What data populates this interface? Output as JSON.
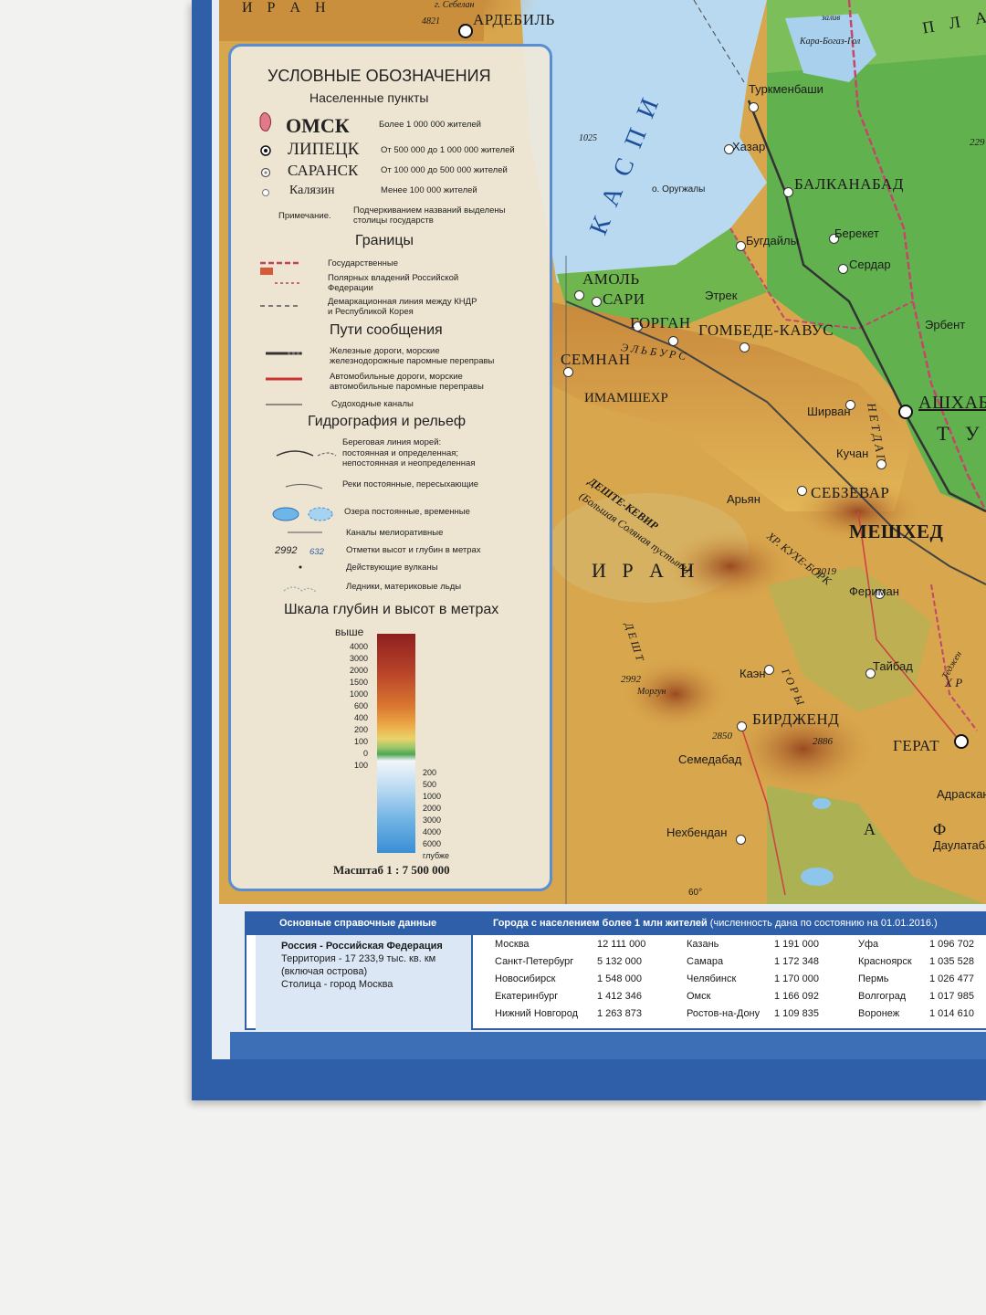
{
  "map": {
    "cities": [
      {
        "name": "АРДЕБИЛЬ",
        "big": false
      },
      {
        "name": "Туркменбаши",
        "big": false
      },
      {
        "name": "Хазар",
        "big": false
      },
      {
        "name": "БАЛКАНАБАД",
        "big": false
      },
      {
        "name": "Берекет",
        "big": false
      },
      {
        "name": "Бугдайлы",
        "big": false
      },
      {
        "name": "Сердар",
        "big": false
      },
      {
        "name": "Этрек",
        "big": false
      },
      {
        "name": "АМОЛЬ",
        "big": false
      },
      {
        "name": "САРИ",
        "big": false
      },
      {
        "name": "ГОРГАН",
        "big": false
      },
      {
        "name": "ГОМБЕДЕ-КАВУС",
        "big": false
      },
      {
        "name": "СЕМНАН",
        "big": false
      },
      {
        "name": "ИМАМШЕХР",
        "big": false
      },
      {
        "name": "Эрбент",
        "big": false
      },
      {
        "name": "АШХАБ",
        "big": false
      },
      {
        "name": "Ширван",
        "big": false
      },
      {
        "name": "Кучан",
        "big": false
      },
      {
        "name": "Арьян",
        "big": false
      },
      {
        "name": "СЕБЗЕВАР",
        "big": false
      },
      {
        "name": "МЕШХЕД",
        "big": true
      },
      {
        "name": "Фериман",
        "big": false
      },
      {
        "name": "Тайбад",
        "big": false
      },
      {
        "name": "Каэн",
        "big": false
      },
      {
        "name": "БИРДЖЕНД",
        "big": false
      },
      {
        "name": "ГЕРАТ",
        "big": false
      },
      {
        "name": "Семедабад",
        "big": false
      },
      {
        "name": "Нехбендан",
        "big": false
      },
      {
        "name": "Адраскан",
        "big": false
      },
      {
        "name": "Даулатабад",
        "big": false
      }
    ],
    "sea_label": "К А С П И",
    "country_iran": "И Р А Н",
    "country_iran_top": "И Р А Н",
    "country_tu": "Т У",
    "plateau": "П Л А",
    "desert_title": "ДЕШТЕ-КЕВИР",
    "desert_sub": "(Большая Соляная пустыня)",
    "range1": "ХР. КУХЕ-БОРК",
    "range2": "Г О Р Ы",
    "range3": "Д Е Ш Т",
    "river": "Э Л Ь Б У Р С",
    "bay": "залив",
    "bay_name": "Кара-Богаз-Гол",
    "island": "о. Оругжалы",
    "depth1": "1025",
    "heights": [
      "4821",
      "2992",
      "2850",
      "2886",
      "3019",
      "229"
    ],
    "morgun": "Моргун",
    "sebelan": "г. Себелан",
    "meridian": "60°",
    "kopet": "Н Е Т Д А Г",
    "kh": "Х Р",
    "a_letter": "А",
    "f_letter": "Ф",
    "tejen": "Теджен"
  },
  "legend": {
    "title": "УСЛОВНЫЕ ОБОЗНАЧЕНИЯ",
    "settlements_title": "Населенные пункты",
    "settlements": [
      {
        "name": "ОМСК",
        "desc": "Более 1 000 000 жителей"
      },
      {
        "name": "ЛИПЕЦК",
        "desc": "От 500 000 до 1 000 000 жителей"
      },
      {
        "name": "САРАНСК",
        "desc": "От 100 000 до 500 000 жителей"
      },
      {
        "name": "Калязин",
        "desc": "Менее 100 000 жителей"
      }
    ],
    "note_label": "Примечание.",
    "note_text_1": "Подчеркиванием названий выделены",
    "note_text_2": "столицы государств",
    "borders_title": "Границы",
    "borders": [
      {
        "l1": "Государственные",
        "l2": ""
      },
      {
        "l1": "Полярных владений Российской",
        "l2": "Федерации"
      },
      {
        "l1": "Демаркационная линия между КНДР",
        "l2": "и Республикой Корея"
      }
    ],
    "routes_title": "Пути сообщения",
    "routes": [
      {
        "l1": "Железные дороги, морские",
        "l2": "железнодорожные паромные переправы"
      },
      {
        "l1": "Автомобильные дороги, морские",
        "l2": "автомобильные паромные переправы"
      },
      {
        "l1": "Судоходные каналы",
        "l2": ""
      }
    ],
    "hydro_title": "Гидрография и рельеф",
    "hydro": [
      {
        "l1": "Береговая линия морей:",
        "l2": "постоянная и определенная;",
        "l3": "непостоянная и неопределенная"
      },
      {
        "l1": "Реки постоянные, пересыхающие",
        "l2": "",
        "l3": ""
      },
      {
        "l1": "Озера постоянные, временные",
        "l2": "",
        "l3": ""
      },
      {
        "l1": "Каналы мелиоративные",
        "l2": "",
        "l3": ""
      },
      {
        "l1": "Отметки высот и глубин в метрах",
        "l2": "",
        "l3": ""
      },
      {
        "l1": "Действующие вулканы",
        "l2": "",
        "l3": ""
      },
      {
        "l1": "Ледники, материковые льды",
        "l2": "",
        "l3": ""
      }
    ],
    "height_mark": "2992",
    "depth_mark": "632",
    "scale_title": "Шкала глубин и высот в метрах",
    "scale_above": "выше",
    "scale_heights": [
      "4000",
      "3000",
      "2000",
      "1500",
      "1000",
      "600",
      "400",
      "200",
      "100",
      "0",
      "100"
    ],
    "scale_depths": [
      "200",
      "500",
      "1000",
      "2000",
      "3000",
      "4000",
      "6000",
      "глубже"
    ],
    "map_scale": "Масштаб 1 : 7 500 000"
  },
  "info": {
    "left_header": "Основные справочные данные",
    "right_header": "Города с населением более 1 млн жителей",
    "right_header_note": "(численность дана по состоянию на 01.01.2016.)",
    "country_name": "Россия - Российская Федерация",
    "territory_1": "Территория - 17 233,9 тыс. кв. км",
    "territory_2": "(включая острова)",
    "capital": "Столица - город Москва",
    "cities_col1": [
      {
        "city": "Москва",
        "pop": "12 111 000"
      },
      {
        "city": "Санкт-Петербург",
        "pop": "5 132 000"
      },
      {
        "city": "Новосибирск",
        "pop": "1 548 000"
      },
      {
        "city": "Екатеринбург",
        "pop": "1 412 346"
      },
      {
        "city": "Нижний Новгород",
        "pop": "1 263 873"
      }
    ],
    "cities_col2": [
      {
        "city": "Казань",
        "pop": "1 191 000"
      },
      {
        "city": "Самара",
        "pop": "1 172 348"
      },
      {
        "city": "Челябинск",
        "pop": "1 170 000"
      },
      {
        "city": "Омск",
        "pop": "1 166 092"
      },
      {
        "city": "Ростов-на-Дону",
        "pop": "1 109 835"
      }
    ],
    "cities_col3": [
      {
        "city": "Уфа",
        "pop": "1 096 702"
      },
      {
        "city": "Красноярск",
        "pop": "1 035 528"
      },
      {
        "city": "Пермь",
        "pop": "1 026 477"
      },
      {
        "city": "Волгоград",
        "pop": "1 017 985"
      },
      {
        "city": "Воронеж",
        "pop": "1 014 610"
      }
    ]
  },
  "colors": {
    "sea": "#b8d9ef",
    "lowland": "#5fae4f",
    "upland": "#d9a94a",
    "mountain": "#b06a32",
    "frame_blue": "#2f5fa8"
  }
}
